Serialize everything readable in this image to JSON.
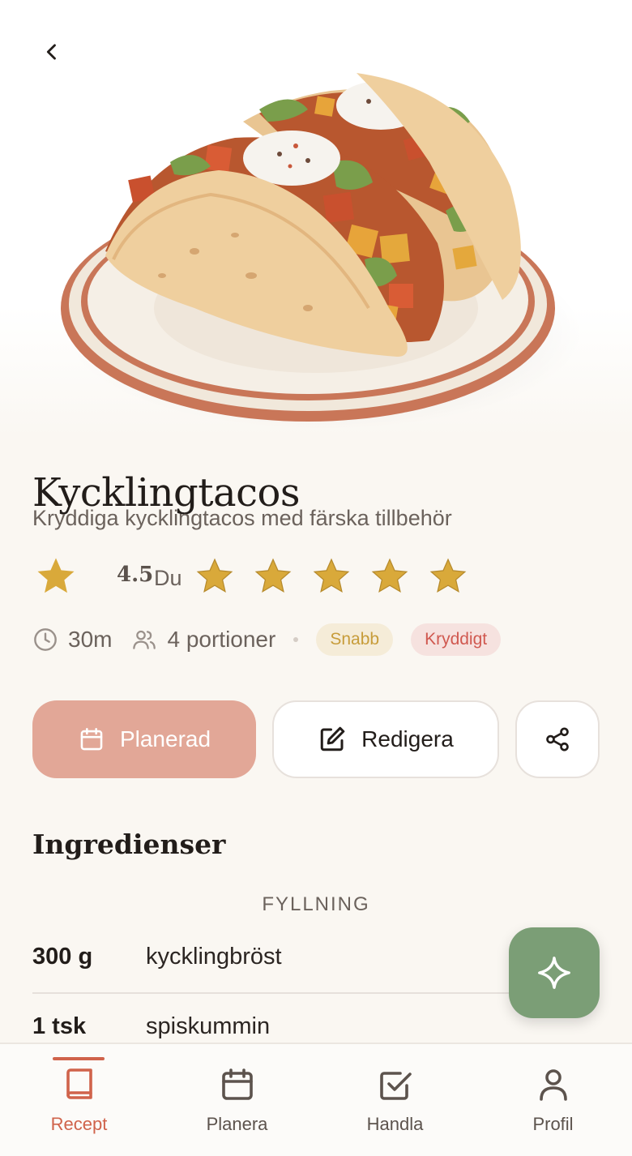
{
  "header": {
    "back_icon": "chevron-left-icon"
  },
  "hero": {
    "image_subject": "chicken tacos on plate"
  },
  "recipe": {
    "title": "Kycklingtacos",
    "subtitle": "Kryddiga kycklingtacos med färska tillbehör",
    "rating": {
      "average": "4.5",
      "you_label": "Du",
      "user_stars": 5
    },
    "time": "30m",
    "servings": "4 portioner",
    "tags": [
      {
        "label": "Snabb",
        "color": "#c79c3a",
        "bg": "#f5ecd8"
      },
      {
        "label": "Kryddigt",
        "color": "#d05950",
        "bg": "#f6e2df"
      }
    ]
  },
  "actions": {
    "planned_label": "Planerad",
    "edit_label": "Redigera",
    "share_icon": "share-icon"
  },
  "ingredients": {
    "section_title": "Ingredienser",
    "groups": [
      {
        "name": "FYLLNING",
        "items": [
          {
            "qty": "300 g",
            "name": "kycklingbröst"
          },
          {
            "qty": "1 tsk",
            "name": "spiskummin"
          }
        ]
      }
    ]
  },
  "fab": {
    "icon": "sparkle-icon"
  },
  "nav": {
    "items": [
      {
        "label": "Recept",
        "icon": "book-icon",
        "active": true
      },
      {
        "label": "Planera",
        "icon": "calendar-icon",
        "active": false
      },
      {
        "label": "Handla",
        "icon": "checkbox-icon",
        "active": false
      },
      {
        "label": "Profil",
        "icon": "user-icon",
        "active": false
      }
    ]
  },
  "colors": {
    "accent": "#d0634b",
    "planned_button": "#e2a797",
    "star": "#d9a93a",
    "fab": "#7b9e76",
    "background": "#faf7f2"
  }
}
